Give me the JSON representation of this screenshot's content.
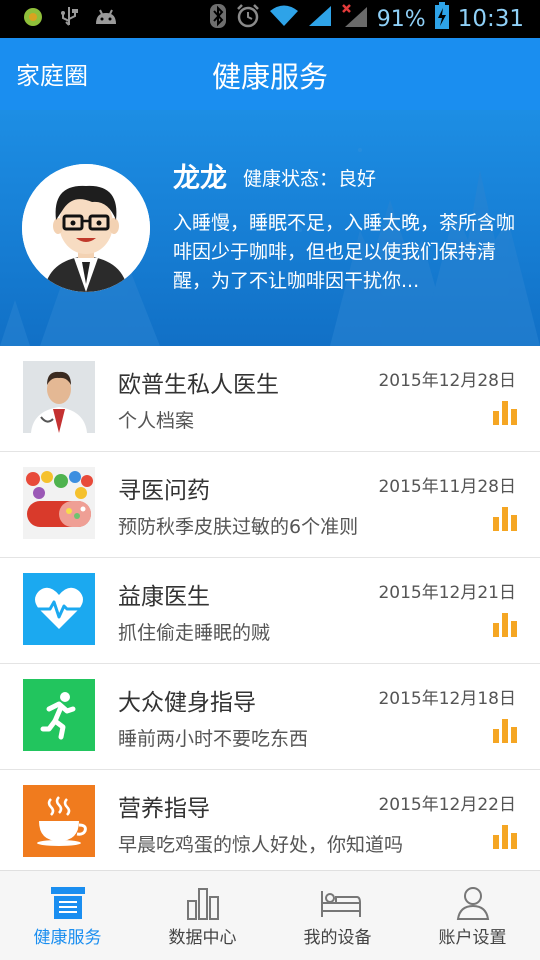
{
  "status_bar": {
    "battery_percent": "91%",
    "time": "10:31"
  },
  "header": {
    "back_label": "家庭圈",
    "title": "健康服务"
  },
  "profile": {
    "name": "龙龙",
    "status_label": "健康状态：",
    "status_value": "良好",
    "description": "入睡慢，睡眠不足，入睡太晚，茶所含咖啡因少于咖啡，但也足以使我们保持清醒，为了不让咖啡因干扰你..."
  },
  "list": {
    "items": [
      {
        "title": "欧普生私人医生",
        "date": "2015年12月28日",
        "subtitle": "个人档案",
        "icon": "doctor-photo"
      },
      {
        "title": "寻医问药",
        "date": "2015年11月28日",
        "subtitle": "预防秋季皮肤过敏的6个准则",
        "icon": "pills-photo"
      },
      {
        "title": "益康医生",
        "date": "2015年12月21日",
        "subtitle": "抓住偷走睡眠的贼",
        "icon": "heart-pulse-icon"
      },
      {
        "title": "大众健身指导",
        "date": "2015年12月18日",
        "subtitle": "睡前两小时不要吃东西",
        "icon": "running-man-icon"
      },
      {
        "title": "营养指导",
        "date": "2015年12月22日",
        "subtitle": "早晨吃鸡蛋的惊人好处，你知道吗",
        "icon": "coffee-cup-icon"
      }
    ]
  },
  "bottom_nav": {
    "items": [
      {
        "label": "健康服务",
        "icon": "list-box-icon",
        "active": true
      },
      {
        "label": "数据中心",
        "icon": "bar-chart-icon",
        "active": false
      },
      {
        "label": "我的设备",
        "icon": "bed-icon",
        "active": false
      },
      {
        "label": "账户设置",
        "icon": "person-icon",
        "active": false
      }
    ]
  },
  "colors": {
    "primary": "#1a8ef0",
    "accent_bars": "#f5a623",
    "tile_blue": "#1ba9f0",
    "tile_green": "#22c55e",
    "tile_orange": "#f07b1e"
  }
}
